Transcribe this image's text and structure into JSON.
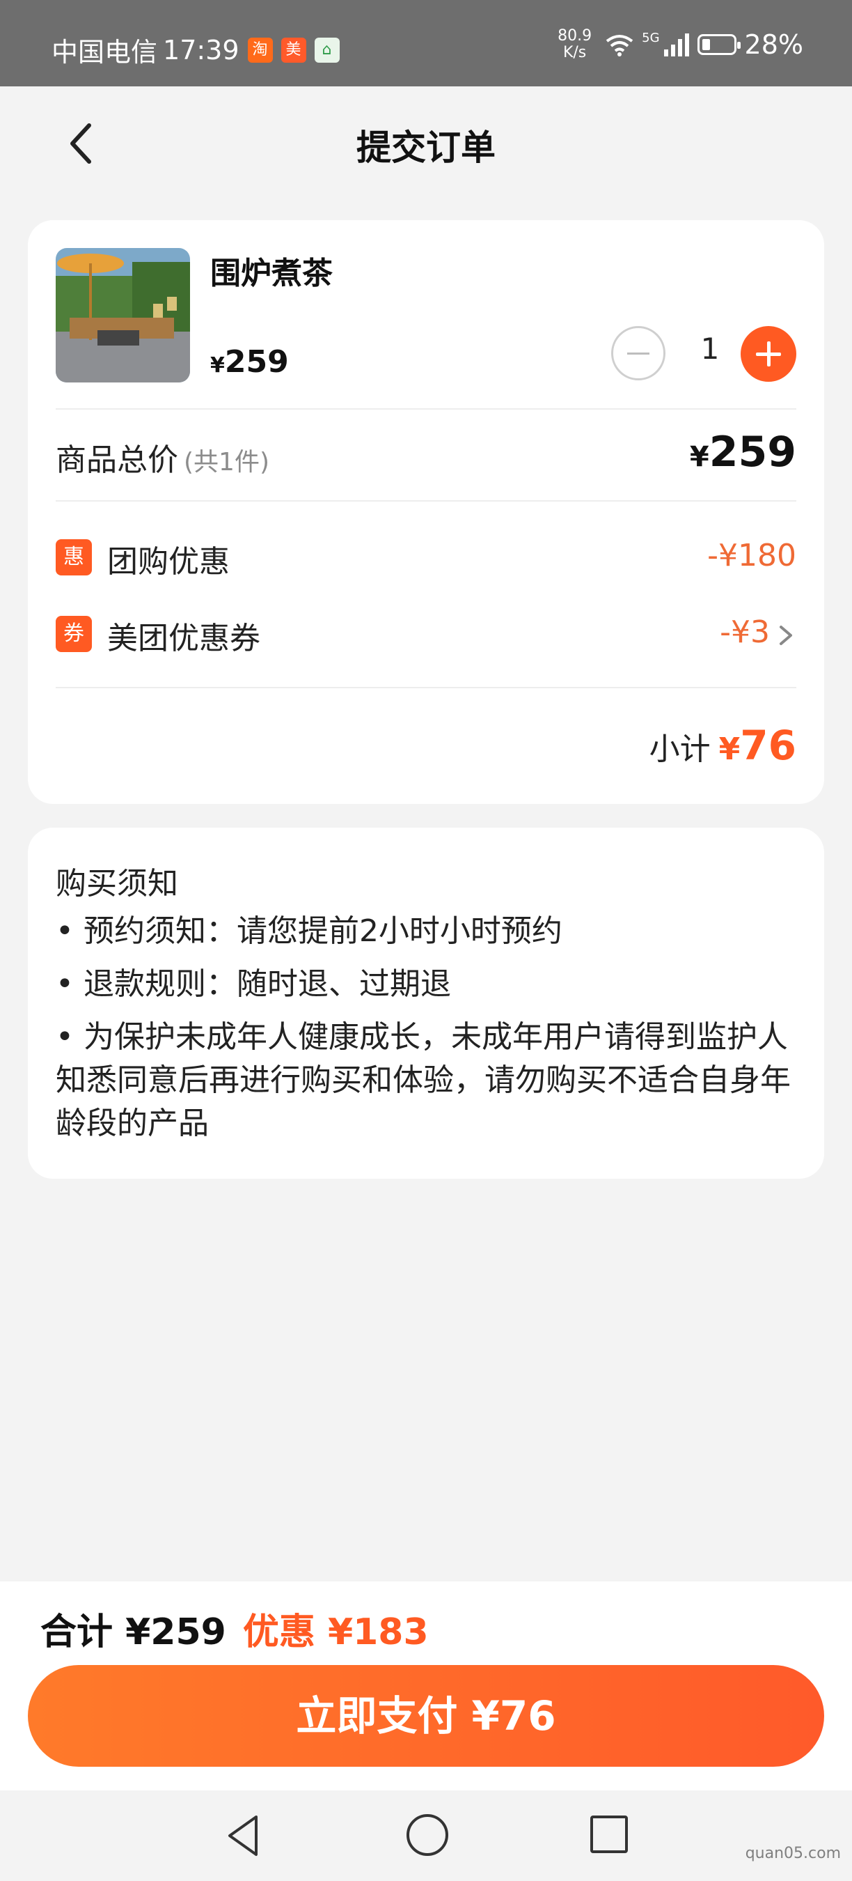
{
  "status_bar": {
    "carrier": "中国电信",
    "time": "17:39",
    "app_icons": [
      "taobao-icon",
      "meituan-icon",
      "home-icon"
    ],
    "net_speed_value": "80.9",
    "net_speed_unit": "K/s",
    "network": "5G",
    "battery": "28%",
    "battery_level": 0.28
  },
  "header": {
    "title": "提交订单"
  },
  "product": {
    "name": "围炉煮茶",
    "currency": "¥",
    "price": "259",
    "quantity": "1"
  },
  "summary": {
    "total_label": "商品总价",
    "count_note": "(共1件)",
    "total_currency": "¥",
    "total_value": "259"
  },
  "discounts": [
    {
      "tag": "惠",
      "label": "团购优惠",
      "value": "-¥180"
    },
    {
      "tag": "券",
      "label": "美团优惠券",
      "value": "-¥3"
    }
  ],
  "subtotal": {
    "label": "小计",
    "currency": "¥",
    "value": "76"
  },
  "notice": {
    "title": "购买须知",
    "items": [
      "• 预约须知：请您提前2小时小时预约",
      "• 退款规则：随时退、过期退",
      "• 为保护未成年人健康成长，未成年用户请得到监护人知悉同意后再进行购买和体验，请勿购买不适合自身年龄段的产品"
    ]
  },
  "bottom": {
    "total_text": "合计 ¥259",
    "discount_text": "优惠 ¥183",
    "pay_button": "立即支付  ¥76"
  },
  "watermark": "quan05.com",
  "colors": {
    "accent": "#ff5a22",
    "discount_text": "#ef6a35",
    "background": "#f3f3f3"
  }
}
